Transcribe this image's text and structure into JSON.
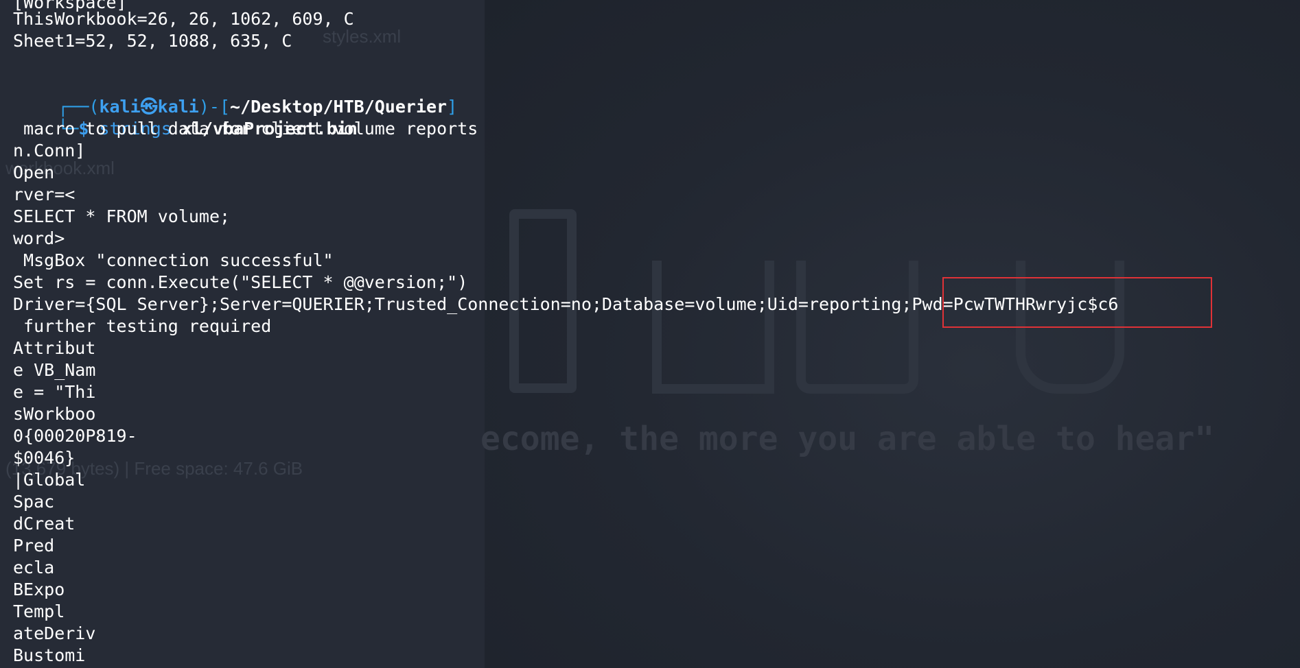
{
  "background": {
    "ghost_file_1": "styles.xml",
    "ghost_file_2": "workbook.xml",
    "ghost_status": "(13,679 bytes) | Free space: 47.6 GiB",
    "quote": "ecome, the more you are able to hear\""
  },
  "terminal": {
    "top_lines": [
      "[Workspace]",
      "ThisWorkbook=26, 26, 1062, 609, C",
      "Sheet1=52, 52, 1088, 635, C"
    ],
    "prompt": {
      "frame_open": "┌──(",
      "user": "kali㉿kali",
      "frame_mid": ")-[",
      "path": "~/Desktop/HTB/Querier",
      "frame_close": "]",
      "frame_bottom": "└─",
      "dollar": "$",
      "command": "strings",
      "argument": "xl/vbaProject.bin"
    },
    "output_lines": [
      " macro to pull data for client volume reports",
      "n.Conn]",
      "Open",
      "rver=<",
      "SELECT * FROM volume;",
      "word>",
      " MsgBox \"connection successful\"",
      "Set rs = conn.Execute(\"SELECT * @@version;\")",
      "Driver={SQL Server};Server=QUERIER;Trusted_Connection=no;Database=volume;Uid=reporting;Pwd=PcwTWTHRwryjc$c6",
      " further testing required",
      "Attribut",
      "e VB_Nam",
      "e = \"Thi",
      "sWorkboo",
      "0{00020P819-",
      "$0046}",
      "|Global",
      "Spac",
      "dCreat",
      "Pred",
      "ecla",
      "BExpo",
      "Templ",
      "ateDeriv",
      "Bustomi"
    ]
  },
  "colors": {
    "background": "#232833",
    "prompt_blue": "#3ea0f0",
    "highlight_red": "#e03237"
  }
}
